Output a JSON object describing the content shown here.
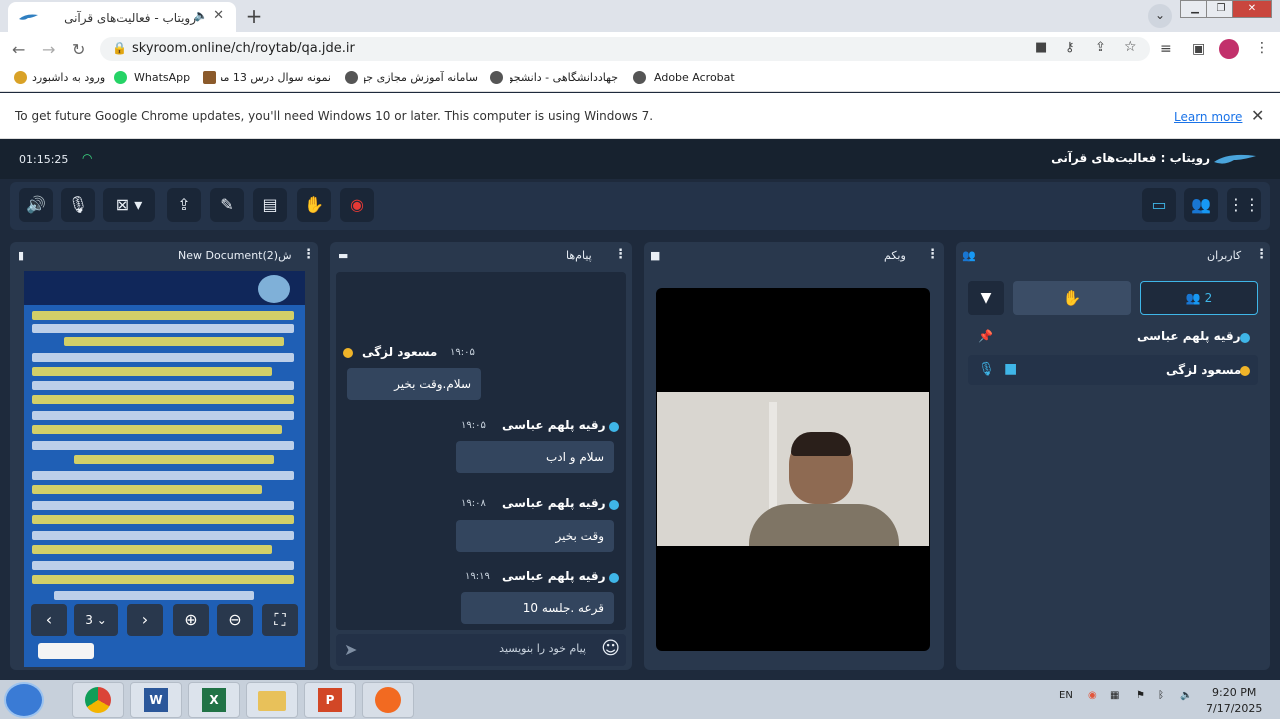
{
  "browser": {
    "tab_title": "رویتاب - فعالیت‌های قرآنی",
    "url": "skyroom.online/ch/roytab/qa.jde.ir",
    "bookmarks": [
      "ورود به داشبورد",
      "WhatsApp",
      "نمونه سوال درس 13 مطا...",
      "سامانه آموزش مجازی جها...",
      "جهاددانشگاهی - دانشجو م...",
      "Adobe Acrobat"
    ],
    "info_message": "To get future Google Chrome updates, you'll need Windows 10 or later. This computer is using Windows 7.",
    "learn_more": "Learn more"
  },
  "app": {
    "timer": "01:15:25",
    "title": "رویتاب : فعالیت‌های قرآنی",
    "accent": "#3fb6e8"
  },
  "panels": {
    "document": {
      "title": "New Document(2)ش",
      "page": "3"
    },
    "messages": {
      "title": "پیام‌ها",
      "placeholder": "پیام خود را بنویسید"
    },
    "webcam": {
      "title": "وبکم"
    },
    "users": {
      "title": "کاربران",
      "count": "2"
    }
  },
  "messages": [
    {
      "sender": "مسعود لزگی",
      "time": "۱۹:۰۵",
      "text": "سلام.وقت بخیر"
    },
    {
      "sender": "رقیه پلهم عباسی",
      "time": "۱۹:۰۵",
      "text": "سلام و ادب"
    },
    {
      "sender": "رقیه پلهم عباسی",
      "time": "۱۹:۰۸",
      "text": "وقت بخیر"
    },
    {
      "sender": "رقیه پلهم عباسی",
      "time": "۱۹:۱۹",
      "text": "قرعه .جلسه 10"
    }
  ],
  "users": [
    {
      "name": "رقیه پلهم عباسی"
    },
    {
      "name": "مسعود لزگی"
    }
  ],
  "taskbar": {
    "lang": "EN",
    "time": "9:20 PM",
    "date": "7/17/2025"
  }
}
